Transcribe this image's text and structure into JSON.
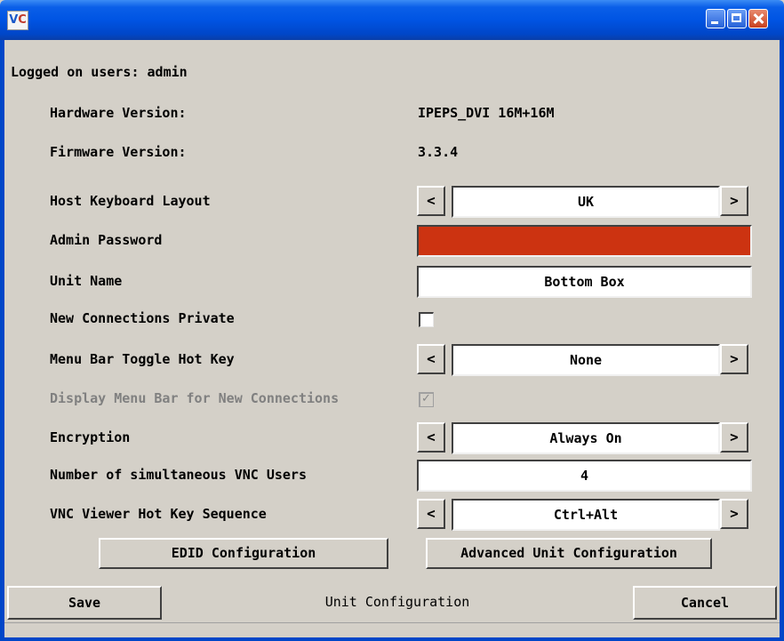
{
  "window": {
    "logo": "V",
    "logo_accent": "C"
  },
  "status": {
    "logged_on_label": "Logged on users:",
    "logged_on_user": "admin"
  },
  "info": [
    {
      "label": "Hardware Version:",
      "value": "IPEPS_DVI 16M+16M"
    },
    {
      "label": "Firmware Version:",
      "value": "3.3.4"
    }
  ],
  "settings": {
    "keyboard": {
      "label": "Host Keyboard Layout",
      "value": "UK"
    },
    "password": {
      "label": "Admin Password",
      "value": ""
    },
    "unit_name": {
      "label": "Unit Name",
      "value": "Bottom Box"
    },
    "private": {
      "label": "New Connections Private",
      "checked": false
    },
    "hotkey": {
      "label": "Menu Bar Toggle Hot Key",
      "value": "None"
    },
    "display_menu": {
      "label": "Display Menu Bar for New Connections",
      "checked": true,
      "enabled": false
    },
    "encryption": {
      "label": "Encryption",
      "value": "Always On"
    },
    "vnc_users": {
      "label": "Number of simultaneous VNC Users",
      "value": "4"
    },
    "vnc_hotkey": {
      "label": "VNC Viewer Hot Key Sequence",
      "value": "Ctrl+Alt"
    }
  },
  "arrows": {
    "prev": "<",
    "next": ">"
  },
  "buttons": {
    "edid": "EDID Configuration",
    "advanced": "Advanced Unit Configuration",
    "save": "Save",
    "cancel": "Cancel"
  },
  "footer": {
    "title": "Unit Configuration"
  },
  "colors": {
    "titlebar": "#0054e3",
    "password_field": "#cc3311",
    "background": "#d4d0c8"
  }
}
